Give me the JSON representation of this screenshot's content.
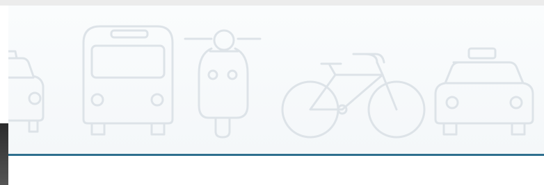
{
  "banner": {
    "icons": [
      {
        "name": "taxi-icon",
        "partial": true
      },
      {
        "name": "bus-icon"
      },
      {
        "name": "scooter-icon"
      },
      {
        "name": "bicycle-icon"
      },
      {
        "name": "taxi-icon"
      }
    ]
  },
  "colors": {
    "banner_bg": "#f4f7f9",
    "icon_stroke": "#dde3e8",
    "divider": "#2e6f8e",
    "content_bg": "#ffffff"
  }
}
